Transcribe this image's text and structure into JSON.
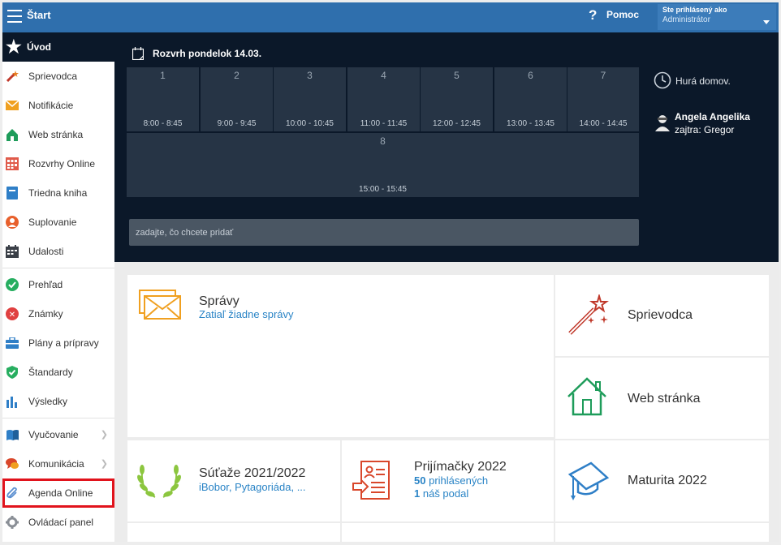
{
  "topbar": {
    "title": "Štart",
    "help_label": "Pomoc",
    "help_symbol": "?",
    "user_line1": "Ste prihlásený ako",
    "user_line2": "Administrátor"
  },
  "sidebar": {
    "home": "Úvod",
    "group1": [
      {
        "label": "Sprievodca",
        "icon": "magic-wand-icon"
      },
      {
        "label": "Notifikácie",
        "icon": "envelope-icon"
      },
      {
        "label": "Web stránka",
        "icon": "house-icon"
      },
      {
        "label": "Rozvrhy Online",
        "icon": "timetable-icon"
      },
      {
        "label": "Triedna kniha",
        "icon": "book-icon"
      },
      {
        "label": "Suplovanie",
        "icon": "substitute-person-icon"
      },
      {
        "label": "Udalosti",
        "icon": "calendar-icon"
      }
    ],
    "group2": [
      {
        "label": "Prehľad",
        "icon": "check-circle-icon"
      },
      {
        "label": "Známky",
        "icon": "grade-circle-icon"
      },
      {
        "label": "Plány a prípravy",
        "icon": "briefcase-icon"
      },
      {
        "label": "Štandardy",
        "icon": "shield-check-icon"
      },
      {
        "label": "Výsledky",
        "icon": "bar-chart-icon"
      }
    ],
    "group3": [
      {
        "label": "Vyučovanie",
        "icon": "open-book-icon"
      },
      {
        "label": "Komunikácia",
        "icon": "chat-bubbles-icon"
      },
      {
        "label": "Agenda Online",
        "icon": "paperclip-icon"
      },
      {
        "label": "Ovládací panel",
        "icon": "gear-icon"
      }
    ]
  },
  "schedule": {
    "title": "Rozvrh pondelok 14.03.",
    "slots": [
      {
        "num": "1",
        "time": "8:00 - 8:45"
      },
      {
        "num": "2",
        "time": "9:00 - 9:45"
      },
      {
        "num": "3",
        "time": "10:00 - 10:45"
      },
      {
        "num": "4",
        "time": "11:00 - 11:45"
      },
      {
        "num": "5",
        "time": "12:00 - 12:45"
      },
      {
        "num": "6",
        "time": "13:00 - 13:45"
      },
      {
        "num": "7",
        "time": "14:00 - 14:45"
      },
      {
        "num": "8",
        "time": "15:00 - 15:45"
      }
    ],
    "add_placeholder": "zadajte, čo chcete pridať",
    "clock_text": "Hurá domov.",
    "duty_name": "Angela Angelika",
    "duty_next": "zajtra: Gregor"
  },
  "cards": {
    "spravy": {
      "title": "Správy",
      "sub": "Zatiaľ žiadne správy"
    },
    "sprievodca": {
      "title": "Sprievodca"
    },
    "web": {
      "title": "Web stránka"
    },
    "sutaze": {
      "title": "Súťaže 2021/2022",
      "sub": "iBobor, Pytagoriáda, ..."
    },
    "prijimacky": {
      "title": "Prijímačky 2022",
      "count1": "50",
      "text1": "prihlásených",
      "count2": "1",
      "text2": "náš podal"
    },
    "maturita": {
      "title": "Maturita 2022"
    }
  },
  "colors": {
    "topbar": "#2f6fad",
    "dark_panel": "#0b1829",
    "slot": "#263445",
    "link": "#2a84c6",
    "highlight": "#e1131c"
  }
}
